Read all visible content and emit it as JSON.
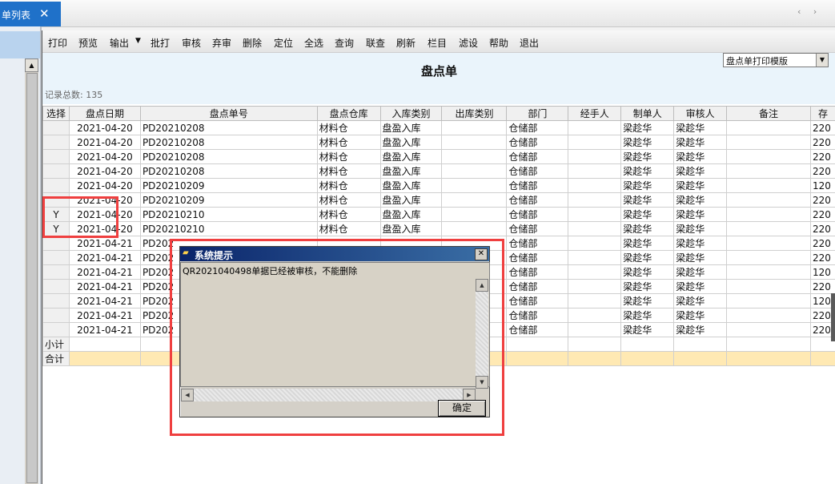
{
  "tab": {
    "label": "单列表",
    "close": "✕",
    "nav": "‹ ›"
  },
  "toolbar": {
    "items": [
      "打印",
      "预览",
      "输出",
      "批打",
      "审核",
      "弃审",
      "删除",
      "定位",
      "全选",
      "查询",
      "联查",
      "刷新",
      "栏目",
      "滤设",
      "帮助",
      "退出"
    ],
    "output_arrow": "▼"
  },
  "header": {
    "title": "盘点单",
    "template_select": "盘点单打印模版",
    "record_count": "记录总数: 135"
  },
  "grid": {
    "columns": [
      "选择",
      "盘点日期",
      "盘点单号",
      "盘点仓库",
      "入库类别",
      "出库类别",
      "部门",
      "经手人",
      "制单人",
      "审核人",
      "备注",
      "存"
    ],
    "rows": [
      [
        "",
        "2021-04-20",
        "PD20210208",
        "材料仓",
        "盘盈入库",
        "",
        "仓储部",
        "",
        "梁趁华",
        "梁趁华",
        "",
        "220"
      ],
      [
        "",
        "2021-04-20",
        "PD20210208",
        "材料仓",
        "盘盈入库",
        "",
        "仓储部",
        "",
        "梁趁华",
        "梁趁华",
        "",
        "220"
      ],
      [
        "",
        "2021-04-20",
        "PD20210208",
        "材料仓",
        "盘盈入库",
        "",
        "仓储部",
        "",
        "梁趁华",
        "梁趁华",
        "",
        "220"
      ],
      [
        "",
        "2021-04-20",
        "PD20210208",
        "材料仓",
        "盘盈入库",
        "",
        "仓储部",
        "",
        "梁趁华",
        "梁趁华",
        "",
        "220"
      ],
      [
        "",
        "2021-04-20",
        "PD20210209",
        "材料仓",
        "盘盈入库",
        "",
        "仓储部",
        "",
        "梁趁华",
        "梁趁华",
        "",
        "120"
      ],
      [
        "",
        "2021-04-20",
        "PD20210209",
        "材料仓",
        "盘盈入库",
        "",
        "仓储部",
        "",
        "梁趁华",
        "梁趁华",
        "",
        "220"
      ],
      [
        "Y",
        "2021-04-20",
        "PD20210210",
        "材料仓",
        "盘盈入库",
        "",
        "仓储部",
        "",
        "梁趁华",
        "梁趁华",
        "",
        "220"
      ],
      [
        "Y",
        "2021-04-20",
        "PD20210210",
        "材料仓",
        "盘盈入库",
        "",
        "仓储部",
        "",
        "梁趁华",
        "梁趁华",
        "",
        "220"
      ],
      [
        "",
        "2021-04-21",
        "PD202",
        "",
        "",
        "",
        "仓储部",
        "",
        "梁趁华",
        "梁趁华",
        "",
        "220"
      ],
      [
        "",
        "2021-04-21",
        "PD202",
        "",
        "",
        "",
        "仓储部",
        "",
        "梁趁华",
        "梁趁华",
        "",
        "220"
      ],
      [
        "",
        "2021-04-21",
        "PD202",
        "",
        "",
        "",
        "仓储部",
        "",
        "梁趁华",
        "梁趁华",
        "",
        "120"
      ],
      [
        "",
        "2021-04-21",
        "PD202",
        "",
        "",
        "",
        "仓储部",
        "",
        "梁趁华",
        "梁趁华",
        "",
        "220"
      ],
      [
        "",
        "2021-04-21",
        "PD202",
        "",
        "",
        "",
        "仓储部",
        "",
        "梁趁华",
        "梁趁华",
        "",
        "120"
      ],
      [
        "",
        "2021-04-21",
        "PD202",
        "",
        "",
        "",
        "仓储部",
        "",
        "梁趁华",
        "梁趁华",
        "",
        "220"
      ],
      [
        "",
        "2021-04-21",
        "PD202",
        "",
        "",
        "",
        "仓储部",
        "",
        "梁趁华",
        "梁趁华",
        "",
        "220"
      ]
    ],
    "subtotal_label": "小计",
    "total_label": "合计"
  },
  "dialog": {
    "title": "系统提示",
    "message": "QR2021040498单据已经被审核，不能删除",
    "ok_label": "确定",
    "close": "✕"
  },
  "colors": {
    "highlight": "#ef3f3f",
    "tab_active": "#1f71c9",
    "total_row": "#ffe9b3"
  }
}
